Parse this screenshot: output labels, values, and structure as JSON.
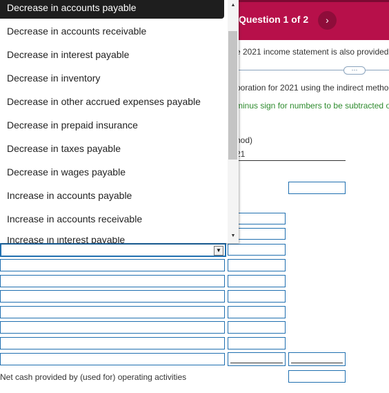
{
  "header": {
    "question_label": "Question 1 of 2",
    "next_glyph": "›",
    "color": "#b7104a"
  },
  "instructions": {
    "line1": "e 2021 income statement is also provided.",
    "line2": "poration for 2021 using the indirect metho",
    "line3": "minus sign for numbers to be subtracted or"
  },
  "expand_button": "⋯",
  "column_header": {
    "line1": "hod)",
    "line2": "21"
  },
  "dropdown": {
    "options": [
      "Decrease in accounts payable",
      "Decrease in accounts receivable",
      "Decrease in interest payable",
      "Decrease in inventory",
      "Decrease in other accrued expenses payable",
      "Decrease in prepaid insurance",
      "Decrease in taxes payable",
      "Decrease in wages payable",
      "Increase in accounts payable",
      "Increase in accounts receivable",
      "Increase in interest payable"
    ],
    "selected_index": 0
  },
  "select_arrow": "▼",
  "scroll": {
    "up": "▲",
    "down": "▼"
  },
  "net_cash_label": "Net cash provided by (used for) operating activities"
}
